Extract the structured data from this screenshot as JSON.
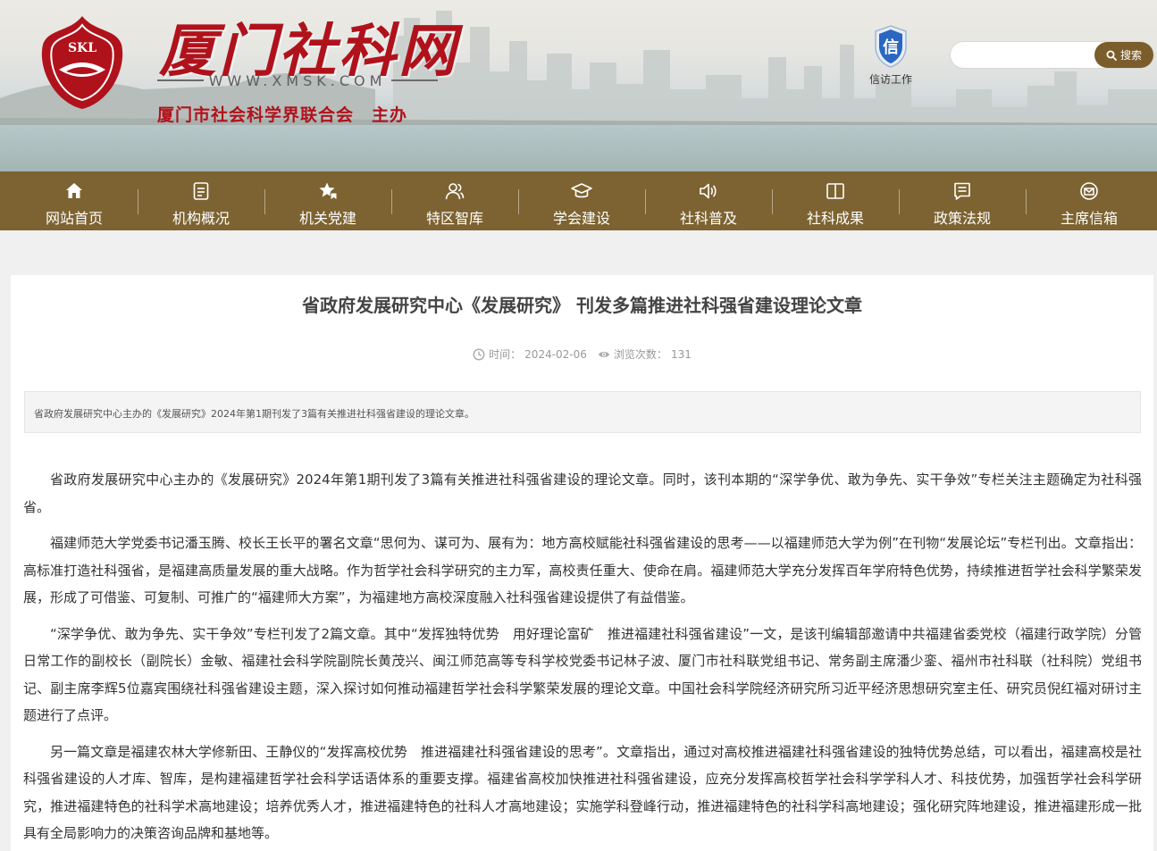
{
  "header": {
    "logo_emblem_text": "SKL",
    "site_title": "厦门社科网",
    "site_url": "WWW.XMSK.COM",
    "sponsor": "厦门市社会科学界联合会　主办",
    "xinfang": {
      "badge": "信",
      "label": "信访工作"
    },
    "search": {
      "value": "",
      "placeholder": "",
      "button_label": "搜索"
    }
  },
  "nav": [
    {
      "label": "网站首页",
      "icon": "home-icon"
    },
    {
      "label": "机构概况",
      "icon": "document-icon"
    },
    {
      "label": "机关党建",
      "icon": "star-flag-icon"
    },
    {
      "label": "特区智库",
      "icon": "people-icon"
    },
    {
      "label": "学会建设",
      "icon": "graduation-cap-icon"
    },
    {
      "label": "社科普及",
      "icon": "speaker-icon"
    },
    {
      "label": "社科成果",
      "icon": "book-icon"
    },
    {
      "label": "政策法规",
      "icon": "chat-doc-icon"
    },
    {
      "label": "主席信箱",
      "icon": "mailbox-icon"
    }
  ],
  "article": {
    "title": "省政府发展研究中心《发展研究》 刊发多篇推进社科强省建设理论文章",
    "meta": {
      "time_label": "时间：",
      "time_value": "2024-02-06",
      "views_label": "浏览次数：",
      "views_value": "131"
    },
    "summary": "省政府发展研究中心主办的《发展研究》2024年第1期刊发了3篇有关推进社科强省建设的理论文章。",
    "paragraphs": [
      "省政府发展研究中心主办的《发展研究》2024年第1期刊发了3篇有关推进社科强省建设的理论文章。同时，该刊本期的“深学争优、敢为争先、实干争效”专栏关注主题确定为社科强省。",
      "福建师范大学党委书记潘玉腾、校长王长平的署名文章“思何为、谋可为、展有为：地方高校赋能社科强省建设的思考——以福建师范大学为例”在刊物“发展论坛”专栏刊出。文章指出：高标准打造社科强省，是福建高质量发展的重大战略。作为哲学社会科学研究的主力军，高校责任重大、使命在肩。福建师范大学充分发挥百年学府特色优势，持续推进哲学社会科学繁荣发展，形成了可借鉴、可复制、可推广的“福建师大方案”，为福建地方高校深度融入社科强省建设提供了有益借鉴。",
      "“深学争优、敢为争先、实干争效”专栏刊发了2篇文章。其中“发挥独特优势　用好理论富矿　推进福建社科强省建设”一文，是该刊编辑部邀请中共福建省委党校（福建行政学院）分管日常工作的副校长（副院长）金敏、福建社会科学院副院长黄茂兴、闽江师范高等专科学校党委书记林子波、厦门市社科联党组书记、常务副主席潘少銮、福州市社科联（社科院）党组书记、副主席李辉5位嘉宾围绕社科强省建设主题，深入探讨如何推动福建哲学社会科学繁荣发展的理论文章。中国社会科学院经济研究所习近平经济思想研究室主任、研究员倪红福对研讨主题进行了点评。",
      "另一篇文章是福建农林大学修新田、王静仪的“发挥高校优势　推进福建社科强省建设的思考”。文章指出，通过对高校推进福建社科强省建设的独特优势总结，可以看出，福建高校是社科强省建设的人才库、智库，是构建福建哲学社会科学话语体系的重要支撑。福建省高校加快推进社科强省建设，应充分发挥高校哲学社会科学学科人才、科技优势，加强哲学社会科学研究，推进福建特色的社科学术高地建设；培养优秀人才，推进福建特色的社科人才高地建设；实施学科登峰行动，推进福建特色的社科学科高地建设；强化研究阵地建设，推进福建形成一批具有全局影响力的决策咨询品牌和基地等。"
    ]
  },
  "colors": {
    "brand_red": "#b0121b",
    "nav_brown": "#7d6331",
    "search_button": "#7b5c2b"
  }
}
